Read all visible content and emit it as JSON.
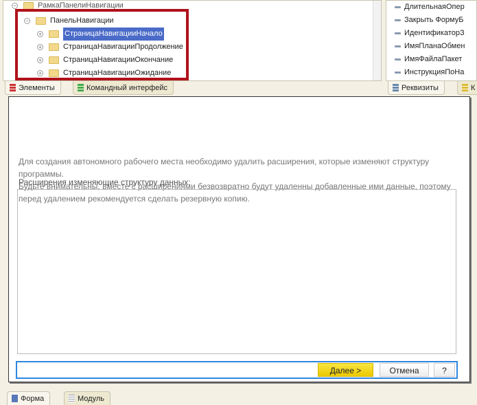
{
  "tree": {
    "parent": "РамкаПанелиНавигации",
    "group": "ПанельНавигации",
    "items": [
      "СтраницаНавигацииНачало",
      "СтраницаНавигацииПродолжение",
      "СтраницаНавигацииОкончание",
      "СтраницаНавигацииОжидание"
    ],
    "selected_index": 0
  },
  "attributes": [
    "ДлительнаяОпер",
    "Закрыть ФормуБ",
    "ИдентификаторЗ",
    "ИмяПланаОбмен",
    "ИмяФайлаПакет",
    "ИнструкцияПоНа"
  ],
  "tabs_left": [
    "Элементы",
    "Командный интерфейс"
  ],
  "tabs_right": [
    "Реквизиты",
    "К"
  ],
  "form": {
    "message_line1": "Для создания автономного рабочего места необходимо удалить расширения, которые изменяют структуру программы.",
    "message_line2": "Будьте внимательны, вместе с расширениями безвозвратно будут удаленны добавленные ими данные, поэтому перед удалением рекомендуется сделать резервную копию.",
    "list_label": "Расширения изменяющие структуру данных:",
    "next_button": "Далее >",
    "cancel_button": "Отмена",
    "help_button": "?"
  },
  "bottom_tabs": [
    "Форма",
    "Модуль"
  ],
  "colors": {
    "highlight": "#b0121b",
    "next": "#f5d800",
    "focus": "#2f86e0"
  }
}
